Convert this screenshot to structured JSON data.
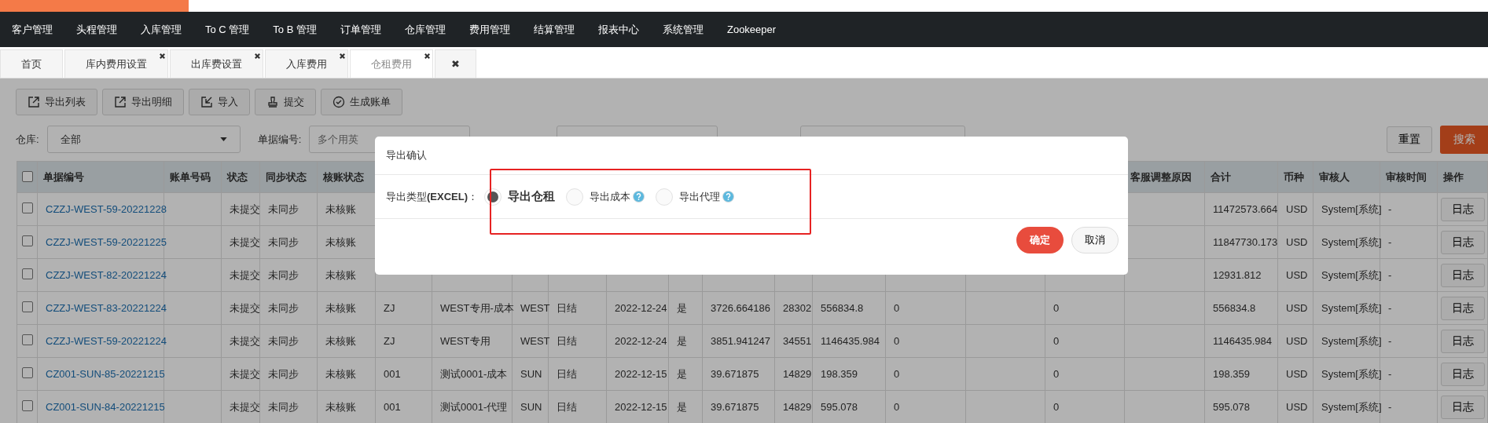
{
  "nav": {
    "items": [
      {
        "label": "客户管理"
      },
      {
        "label": "头程管理"
      },
      {
        "label": "入库管理"
      },
      {
        "label": "To C 管理"
      },
      {
        "label": "To B 管理"
      },
      {
        "label": "订单管理"
      },
      {
        "label": "仓库管理"
      },
      {
        "label": "费用管理"
      },
      {
        "label": "结算管理"
      },
      {
        "label": "报表中心"
      },
      {
        "label": "系统管理"
      },
      {
        "label": "Zookeeper"
      }
    ]
  },
  "tabs": [
    {
      "label": "首页",
      "closable": false,
      "selected": false
    },
    {
      "label": "库内费用设置",
      "closable": true,
      "selected": false
    },
    {
      "label": "出库费设置",
      "closable": true,
      "selected": false
    },
    {
      "label": "入库费用",
      "closable": true,
      "selected": false
    },
    {
      "label": "仓租费用",
      "closable": true,
      "selected": true
    }
  ],
  "close_all": "✖",
  "toolbar": [
    {
      "label": "导出列表",
      "kind": "export"
    },
    {
      "label": "导出明细",
      "kind": "export"
    },
    {
      "label": "导入",
      "kind": "import"
    },
    {
      "label": "提交",
      "kind": "submit"
    },
    {
      "label": "生成账单",
      "kind": "generate"
    }
  ],
  "filters": {
    "warehouse_label": "仓库:",
    "warehouse_value": "全部",
    "doc_label": "单据编号:",
    "doc_placeholder": "多个用英",
    "reset": "重置",
    "search": "搜索"
  },
  "table": {
    "all_checked": false,
    "columns": [
      {
        "label": "单据编号",
        "kind": "link"
      },
      {
        "label": "账单号码",
        "kind": "text"
      },
      {
        "label": "状态",
        "kind": "text"
      },
      {
        "label": "同步状态",
        "kind": "text"
      },
      {
        "label": "核账状态",
        "kind": "text"
      },
      {
        "kind": "text"
      },
      {
        "kind": "text"
      },
      {
        "kind": "text"
      },
      {
        "kind": "text"
      },
      {
        "kind": "text"
      },
      {
        "kind": "text"
      },
      {
        "kind": "text"
      },
      {
        "kind": "text"
      },
      {
        "kind": "text"
      },
      {
        "kind": "text"
      },
      {
        "kind": "text"
      },
      {
        "kind": "text"
      },
      {
        "label": "客服调整原因",
        "kind": "text"
      },
      {
        "label": "合计",
        "kind": "text"
      },
      {
        "label": "币种",
        "kind": "text"
      },
      {
        "label": "审核人",
        "kind": "text"
      },
      {
        "label": "审核时间",
        "kind": "text"
      },
      {
        "label": "操作",
        "kind": "button"
      }
    ],
    "rows": [
      {
        "checked": false,
        "cells": [
          "CZZJ-WEST-59-20221228",
          null,
          "未提交",
          "未同步",
          "未核账",
          null,
          null,
          null,
          null,
          null,
          null,
          null,
          null,
          null,
          null,
          null,
          null,
          null,
          "11472573.664",
          "USD",
          "System[系统]",
          "-",
          "日志"
        ]
      },
      {
        "checked": false,
        "cells": [
          "CZZJ-WEST-59-20221225",
          null,
          "未提交",
          "未同步",
          "未核账",
          null,
          null,
          null,
          null,
          null,
          null,
          null,
          null,
          null,
          null,
          null,
          null,
          null,
          "11847730.173",
          "USD",
          "System[系统]",
          "-",
          "日志"
        ]
      },
      {
        "checked": false,
        "cells": [
          "CZZJ-WEST-82-20221224",
          null,
          "未提交",
          "未同步",
          "未核账",
          null,
          null,
          null,
          null,
          null,
          null,
          null,
          null,
          null,
          null,
          null,
          null,
          null,
          "12931.812",
          "USD",
          "System[系统]",
          "-",
          "日志"
        ]
      },
      {
        "checked": false,
        "cells": [
          "CZZJ-WEST-83-20221224",
          null,
          "未提交",
          "未同步",
          "未核账",
          "ZJ",
          "WEST专用-成本",
          "WEST",
          "日结",
          "2022-12-24",
          "是",
          "3726.664186",
          "28302",
          "556834.8",
          "0",
          null,
          "0",
          null,
          "556834.8",
          "USD",
          "System[系统]",
          "-",
          "日志"
        ]
      },
      {
        "checked": false,
        "cells": [
          "CZZJ-WEST-59-20221224",
          null,
          "未提交",
          "未同步",
          "未核账",
          "ZJ",
          "WEST专用",
          "WEST",
          "日结",
          "2022-12-24",
          "是",
          "3851.941247",
          "34551",
          "1146435.984",
          "0",
          null,
          "0",
          null,
          "1146435.984",
          "USD",
          "System[系统]",
          "-",
          "日志"
        ]
      },
      {
        "checked": false,
        "cells": [
          "CZ001-SUN-85-20221215",
          null,
          "未提交",
          "未同步",
          "未核账",
          "001",
          "测试0001-成本",
          "SUN",
          "日结",
          "2022-12-15",
          "是",
          "39.671875",
          "14829",
          "198.359",
          "0",
          null,
          "0",
          null,
          "198.359",
          "USD",
          "System[系统]",
          "-",
          "日志"
        ]
      },
      {
        "checked": false,
        "cells": [
          "CZ001-SUN-84-20221215",
          null,
          "未提交",
          "未同步",
          "未核账",
          "001",
          "测试0001-代理",
          "SUN",
          "日结",
          "2022-12-15",
          "是",
          "39.671875",
          "14829",
          "595.078",
          "0",
          null,
          "0",
          null,
          "595.078",
          "USD",
          "System[系统]",
          "-",
          "日志"
        ]
      }
    ]
  },
  "dialog": {
    "title": "导出确认",
    "field_label": "导出类型**(EXCEL)**：",
    "options": [
      {
        "label": "导出仓租",
        "selected": true,
        "help": false
      },
      {
        "label": "导出成本",
        "selected": false,
        "help": true
      },
      {
        "label": "导出代理",
        "selected": false,
        "help": true
      }
    ],
    "confirm": "确定",
    "cancel": "取消"
  }
}
